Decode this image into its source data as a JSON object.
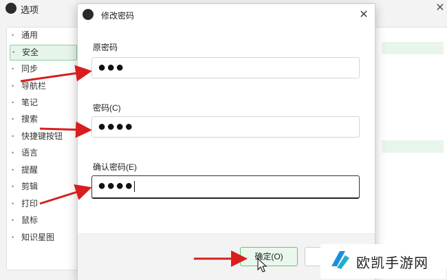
{
  "options_window": {
    "title": "选项",
    "sidebar": [
      {
        "label": "通用",
        "selected": false
      },
      {
        "label": "安全",
        "selected": true
      },
      {
        "label": "同步",
        "selected": false
      },
      {
        "label": "导航栏",
        "selected": false
      },
      {
        "label": "笔记",
        "selected": false
      },
      {
        "label": "搜索",
        "selected": false
      },
      {
        "label": "快捷键按钮",
        "selected": false
      },
      {
        "label": "语言",
        "selected": false
      },
      {
        "label": "提醒",
        "selected": false
      },
      {
        "label": "剪辑",
        "selected": false
      },
      {
        "label": "打印",
        "selected": false
      },
      {
        "label": "鼠标",
        "selected": false
      },
      {
        "label": "知识星图",
        "selected": false
      }
    ]
  },
  "dialog": {
    "title": "修改密码",
    "fields": [
      {
        "label": "原密码",
        "value": "●●●"
      },
      {
        "label": "密码(C)",
        "value": "●●●●"
      },
      {
        "label": "确认密码(E)",
        "value": "●●●●"
      }
    ],
    "ok_label": "确定(O)"
  },
  "watermark": {
    "text": "欧凯手游网"
  },
  "colors": {
    "annotation_arrow": "#d81e1e",
    "accent_green": "#6abf7b"
  }
}
